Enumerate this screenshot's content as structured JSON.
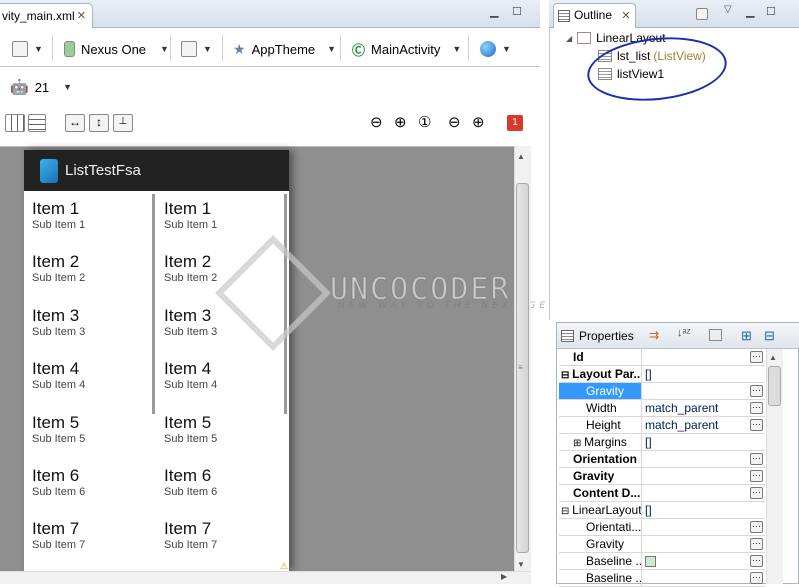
{
  "editor": {
    "tab_label": "vity_main.xml",
    "toolbar": {
      "device": "Nexus One",
      "theme": "AppTheme",
      "activity": "MainActivity",
      "api_level": "21",
      "error_count": "1"
    }
  },
  "app": {
    "title": "ListTestFsa",
    "left_list": [
      {
        "title": "Item 1",
        "sub": "Sub Item 1"
      },
      {
        "title": "Item 2",
        "sub": "Sub Item 2"
      },
      {
        "title": "Item 3",
        "sub": "Sub Item 3"
      },
      {
        "title": "Item 4",
        "sub": "Sub Item 4"
      },
      {
        "title": "Item 5",
        "sub": "Sub Item 5"
      },
      {
        "title": "Item 6",
        "sub": "Sub Item 6"
      },
      {
        "title": "Item 7",
        "sub": "Sub Item 7"
      }
    ],
    "right_list": [
      {
        "title": "Item 1",
        "sub": "Sub Item 1"
      },
      {
        "title": "Item 2",
        "sub": "Sub Item 2"
      },
      {
        "title": "Item 3",
        "sub": "Sub Item 3"
      },
      {
        "title": "Item 4",
        "sub": "Sub Item 4"
      },
      {
        "title": "Item 5",
        "sub": "Sub Item 5"
      },
      {
        "title": "Item 6",
        "sub": "Sub Item 6"
      },
      {
        "title": "Item 7",
        "sub": "Sub Item 7"
      }
    ]
  },
  "watermark": {
    "name": "UNCOCODER",
    "tagline": "NEW WAY TO THE NEXT GEN"
  },
  "outline": {
    "tab_label": "Outline",
    "root": "LinearLayout",
    "child1_name": "lst_list",
    "child1_type": "(ListView)",
    "child2_name": "listView1"
  },
  "properties": {
    "tab_label": "Properties",
    "rows": [
      {
        "name": "Id",
        "value": "",
        "bold": true
      },
      {
        "name": "Layout Par...",
        "value": "[]",
        "bold": true
      },
      {
        "name": "Gravity",
        "value": "",
        "selected": true
      },
      {
        "name": "Width",
        "value": "match_parent"
      },
      {
        "name": "Height",
        "value": "match_parent"
      },
      {
        "name": "Margins",
        "value": "[]"
      },
      {
        "name": "Orientation",
        "value": "",
        "bold": true
      },
      {
        "name": "Gravity",
        "value": "",
        "bold": true
      },
      {
        "name": "Content D...",
        "value": "",
        "bold": true
      },
      {
        "name": "LinearLayout",
        "value": "[]"
      },
      {
        "name": "Orientati...",
        "value": ""
      },
      {
        "name": "Gravity",
        "value": ""
      },
      {
        "name": "Baseline ...",
        "value": ""
      },
      {
        "name": "Baseline ...",
        "value": ""
      }
    ]
  }
}
